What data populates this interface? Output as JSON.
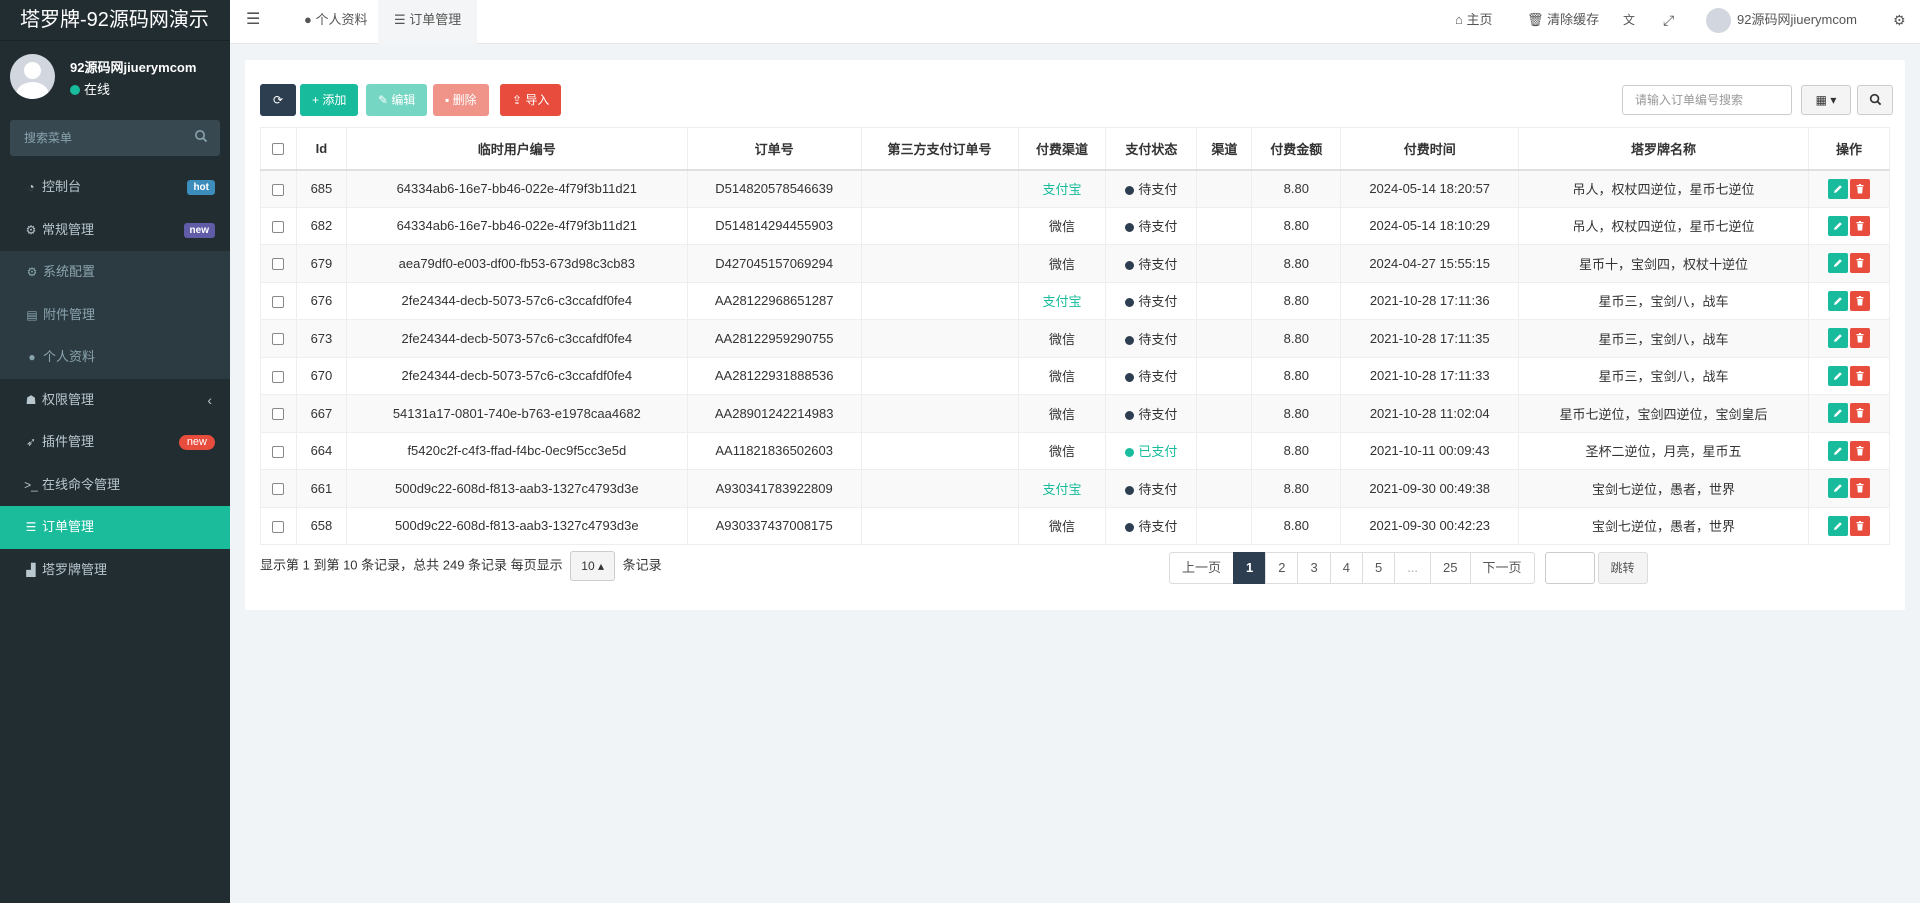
{
  "brand": "塔罗牌-92源码网演示",
  "user": {
    "name": "92源码网jiuerymcom",
    "status": "在线",
    "status_color": "#18bc9c"
  },
  "side_search": {
    "placeholder": "搜索菜单"
  },
  "menu": [
    {
      "label": "控制台",
      "icon": "dashboard-icon",
      "badge": "hot",
      "badge_color": "#3c8dbc"
    },
    {
      "label": "常规管理",
      "icon": "cogs-icon",
      "badge": "new",
      "badge_color": "#605ca8"
    },
    {
      "label": "系统配置",
      "icon": "gear-icon"
    },
    {
      "label": "附件管理",
      "icon": "file-image-icon"
    },
    {
      "label": "个人资料",
      "icon": "user-icon"
    },
    {
      "label": "权限管理",
      "icon": "group-icon"
    },
    {
      "label": "插件管理",
      "icon": "rocket-icon",
      "badge": "new",
      "badge_color": "#e74c3c"
    },
    {
      "label": "在线命令管理",
      "icon": "terminal-icon"
    },
    {
      "label": "订单管理",
      "icon": "list-icon"
    },
    {
      "label": "塔罗牌管理",
      "icon": "chart-icon"
    }
  ],
  "header": {
    "tab_profile": "个人资料",
    "tab_orders": "订单管理",
    "home": "主页",
    "clear_cache": "清除缓存",
    "user": "92源码网jiuerymcom"
  },
  "toolbar": {
    "add": "添加",
    "edit": "编辑",
    "delete": "删除",
    "import": "导入",
    "search_placeholder": "请输入订单编号搜索"
  },
  "table": {
    "headers": [
      "Id",
      "临时用户编号",
      "订单号",
      "第三方支付订单号",
      "付费渠道",
      "支付状态",
      "渠道",
      "付费金额",
      "付费时间",
      "塔罗牌名称",
      "操作"
    ],
    "rows": [
      {
        "id": "685",
        "uid": "64334ab6-16e7-bb46-022e-4f79f3b11d21",
        "order": "D514820578546639",
        "third": "",
        "channel": "支付宝",
        "status": "待支付",
        "src": "",
        "amount": "8.80",
        "time": "2024-05-14 18:20:57",
        "cards": "吊人，权杖四逆位，星币七逆位"
      },
      {
        "id": "682",
        "uid": "64334ab6-16e7-bb46-022e-4f79f3b11d21",
        "order": "D514814294455903",
        "third": "",
        "channel": "微信",
        "status": "待支付",
        "src": "",
        "amount": "8.80",
        "time": "2024-05-14 18:10:29",
        "cards": "吊人，权杖四逆位，星币七逆位"
      },
      {
        "id": "679",
        "uid": "aea79df0-e003-df00-fb53-673d98c3cb83",
        "order": "D427045157069294",
        "third": "",
        "channel": "微信",
        "status": "待支付",
        "src": "",
        "amount": "8.80",
        "time": "2024-04-27 15:55:15",
        "cards": "星币十，宝剑四，权杖十逆位"
      },
      {
        "id": "676",
        "uid": "2fe24344-decb-5073-57c6-c3ccafdf0fe4",
        "order": "AA28122968651287",
        "third": "",
        "channel": "支付宝",
        "status": "待支付",
        "src": "",
        "amount": "8.80",
        "time": "2021-10-28 17:11:36",
        "cards": "星币三，宝剑八，战车"
      },
      {
        "id": "673",
        "uid": "2fe24344-decb-5073-57c6-c3ccafdf0fe4",
        "order": "AA28122959290755",
        "third": "",
        "channel": "微信",
        "status": "待支付",
        "src": "",
        "amount": "8.80",
        "time": "2021-10-28 17:11:35",
        "cards": "星币三，宝剑八，战车"
      },
      {
        "id": "670",
        "uid": "2fe24344-decb-5073-57c6-c3ccafdf0fe4",
        "order": "AA28122931888536",
        "third": "",
        "channel": "微信",
        "status": "待支付",
        "src": "",
        "amount": "8.80",
        "time": "2021-10-28 17:11:33",
        "cards": "星币三，宝剑八，战车"
      },
      {
        "id": "667",
        "uid": "54131a17-0801-740e-b763-e1978caa4682",
        "order": "AA28901242214983",
        "third": "",
        "channel": "微信",
        "status": "待支付",
        "src": "",
        "amount": "8.80",
        "time": "2021-10-28 11:02:04",
        "cards": "星币七逆位，宝剑四逆位，宝剑皇后"
      },
      {
        "id": "664",
        "uid": "f5420c2f-c4f3-ffad-f4bc-0ec9f5cc3e5d",
        "order": "AA11821836502603",
        "third": "",
        "channel": "微信",
        "status": "已支付",
        "src": "",
        "amount": "8.80",
        "time": "2021-10-11 00:09:43",
        "cards": "圣杯二逆位，月亮，星币五"
      },
      {
        "id": "661",
        "uid": "500d9c22-608d-f813-aab3-1327c4793d3e",
        "order": "A930341783922809",
        "third": "",
        "channel": "支付宝",
        "status": "待支付",
        "src": "",
        "amount": "8.80",
        "time": "2021-09-30 00:49:38",
        "cards": "宝剑七逆位，愚者，世界"
      },
      {
        "id": "658",
        "uid": "500d9c22-608d-f813-aab3-1327c4793d3e",
        "order": "A930337437008175",
        "third": "",
        "channel": "微信",
        "status": "待支付",
        "src": "",
        "amount": "8.80",
        "time": "2021-09-30 00:42:23",
        "cards": "宝剑七逆位，愚者，世界"
      }
    ]
  },
  "footer": {
    "info_prefix": "显示第 1 到第 10 条记录，总共 249 条记录 每页显示",
    "page_size": "10",
    "info_suffix": "条记录"
  },
  "pagination": {
    "prev": "上一页",
    "pages": [
      "1",
      "2",
      "3",
      "4",
      "5",
      "...",
      "25"
    ],
    "next": "下一页",
    "jump": "跳转",
    "current": "1"
  },
  "colors": {
    "primary": "#2c3e50",
    "success": "#18bc9c",
    "danger": "#e74c3c",
    "warning": "#f39c12",
    "pending": "#2c3e50",
    "paid": "#18bc9c"
  }
}
